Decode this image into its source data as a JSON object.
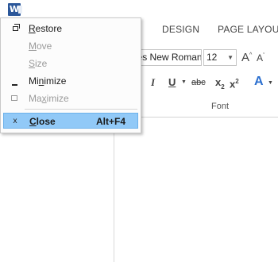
{
  "app": {
    "icon_letter": "W",
    "icon_name": "word-app-icon"
  },
  "ribbon": {
    "tabs": [
      {
        "label": "DESIGN"
      },
      {
        "label": "PAGE LAYOUT"
      }
    ],
    "font_name": "Times New Roman",
    "font_size": "12",
    "grow_font": "A",
    "shrink_font": "A",
    "italic": "I",
    "underline": "U",
    "strikethrough": "abc",
    "subscript": "x",
    "superscript": "x",
    "subscript_mark": "2",
    "superscript_mark": "2",
    "text_effects": "A",
    "group_label": "Font"
  },
  "system_menu": {
    "items": [
      {
        "mnemonic": "R",
        "rest": "estore",
        "shortcut": "",
        "state": "enabled",
        "icon": "restore-icon"
      },
      {
        "mnemonic": "M",
        "rest": "ove",
        "shortcut": "",
        "state": "disabled",
        "icon": ""
      },
      {
        "mnemonic": "S",
        "rest": "ize",
        "shortcut": "",
        "state": "disabled",
        "icon": ""
      },
      {
        "pre": "Mi",
        "mnemonic": "n",
        "rest": "imize",
        "shortcut": "",
        "state": "enabled",
        "icon": "minimize-icon"
      },
      {
        "pre": "Ma",
        "mnemonic": "x",
        "rest": "imize",
        "shortcut": "",
        "state": "disabled",
        "icon": "maximize-icon"
      },
      {
        "mnemonic": "C",
        "rest": "lose",
        "shortcut": "Alt+F4",
        "state": "selected",
        "icon": "close-icon",
        "icon_glyph": "x"
      }
    ]
  },
  "colors": {
    "menu_highlight": "#91c9f7",
    "word_blue": "#2b579a",
    "text_effects_blue": "#2b6fcf",
    "disabled_text": "#9a9a9a"
  }
}
